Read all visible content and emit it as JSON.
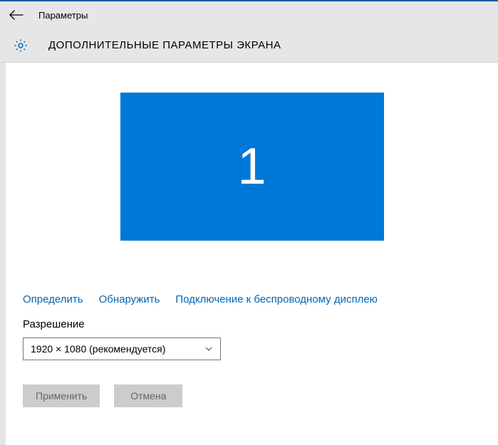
{
  "titlebar": {
    "title": "Параметры"
  },
  "header": {
    "title": "ДОПОЛНИТЕЛЬНЫЕ ПАРАМЕТРЫ ЭКРАНА"
  },
  "monitor": {
    "number": "1"
  },
  "links": {
    "identify": "Определить",
    "detect": "Обнаружить",
    "wireless": "Подключение к беспроводному дисплею"
  },
  "resolution": {
    "label": "Разрешение",
    "value": "1920 × 1080 (рекомендуется)"
  },
  "buttons": {
    "apply": "Применить",
    "cancel": "Отмена"
  }
}
